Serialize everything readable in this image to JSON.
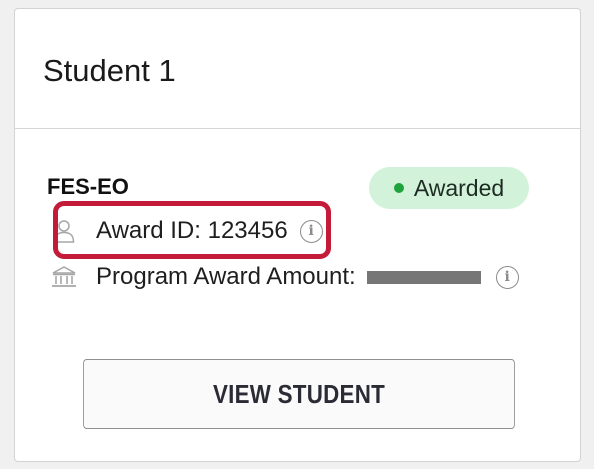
{
  "card": {
    "title": "Student 1",
    "program": "FES-EO",
    "status_badge": "Awarded",
    "status_color": "#1fa43d",
    "badge_bg": "#d2f2d9",
    "award_id_label": "Award ID: 123456",
    "award_amount_label": "Program Award Amount:",
    "highlight_color": "#c41b3a",
    "info_glyph": "i",
    "view_button_label": "VIEW STUDENT"
  },
  "icons": {
    "award_id": "user-icon",
    "award_amount": "bank-icon",
    "info": "info-icon"
  }
}
